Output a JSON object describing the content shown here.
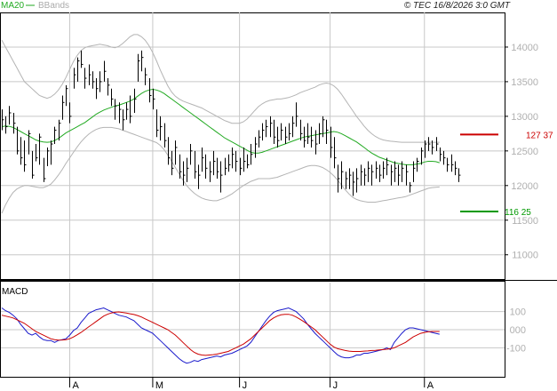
{
  "header": {
    "legend": [
      {
        "label": "MA20",
        "color": "#22aa22"
      },
      {
        "label": "BBands",
        "color": "#aaaaaa"
      }
    ],
    "copyright": "© TEC 16/8/2026 3:0 GMT"
  },
  "colors": {
    "price_bar": "#000000",
    "ma20": "#22aa22",
    "bbands": "#b4b4b4",
    "grid": "#c8c8c8",
    "resistance": "#cc0000",
    "support": "#009900",
    "macd": "#1a1acc",
    "signal": "#cc0000"
  },
  "chart_data": [
    {
      "type": "line",
      "name": "price",
      "ylim": [
        10650,
        14500
      ],
      "yticks": [
        11000,
        11500,
        12000,
        12500,
        13000,
        13500,
        14000
      ],
      "x_month_labels": [
        {
          "label": "A",
          "index": 18
        },
        {
          "label": "M",
          "index": 40
        },
        {
          "label": "J",
          "index": 63
        },
        {
          "label": "J",
          "index": 87
        },
        {
          "label": "A",
          "index": 112
        }
      ],
      "levels": [
        {
          "name": "resistance",
          "value": 12737,
          "label": "127 37"
        },
        {
          "name": "support",
          "value": 11625,
          "label": "116 25"
        }
      ],
      "bars_hlc": [
        [
          13100,
          12800,
          12950
        ],
        [
          13000,
          12750,
          12850
        ],
        [
          13150,
          12880,
          13050
        ],
        [
          13050,
          12750,
          12900
        ],
        [
          12850,
          12450,
          12500
        ],
        [
          12700,
          12300,
          12400
        ],
        [
          12650,
          12200,
          12300
        ],
        [
          12800,
          12450,
          12750
        ],
        [
          12500,
          12100,
          12150
        ],
        [
          12600,
          12350,
          12400
        ],
        [
          12750,
          12300,
          12700
        ],
        [
          12400,
          12050,
          12100
        ],
        [
          12550,
          12280,
          12500
        ],
        [
          12650,
          12300,
          12600
        ],
        [
          12850,
          12600,
          12800
        ],
        [
          12950,
          12650,
          12900
        ],
        [
          13300,
          12950,
          13200
        ],
        [
          13450,
          13150,
          13400
        ],
        [
          13200,
          12900,
          13000
        ],
        [
          13700,
          13400,
          13600
        ],
        [
          13850,
          13500,
          13800
        ],
        [
          13950,
          13700,
          13750
        ],
        [
          13700,
          13400,
          13550
        ],
        [
          13750,
          13450,
          13600
        ],
        [
          13650,
          13400,
          13500
        ],
        [
          13550,
          13250,
          13400
        ],
        [
          13650,
          13350,
          13500
        ],
        [
          13800,
          13500,
          13650
        ],
        [
          13550,
          13300,
          13450
        ],
        [
          13400,
          13150,
          13250
        ],
        [
          13250,
          12950,
          13150
        ],
        [
          13200,
          12900,
          13100
        ],
        [
          13100,
          12800,
          12950
        ],
        [
          13200,
          12950,
          13100
        ],
        [
          13300,
          12900,
          13000
        ],
        [
          13400,
          13050,
          13250
        ],
        [
          13900,
          13500,
          13800
        ],
        [
          13950,
          13650,
          13850
        ],
        [
          13700,
          13450,
          13600
        ],
        [
          13550,
          13200,
          13300
        ],
        [
          13400,
          13100,
          13250
        ],
        [
          13100,
          12700,
          12800
        ],
        [
          13000,
          12650,
          12850
        ],
        [
          12900,
          12550,
          12650
        ],
        [
          12700,
          12300,
          12400
        ],
        [
          12500,
          12150,
          12250
        ],
        [
          12650,
          12300,
          12550
        ],
        [
          12450,
          12100,
          12200
        ],
        [
          12350,
          12000,
          12150
        ],
        [
          12400,
          12050,
          12250
        ],
        [
          12600,
          12300,
          12500
        ],
        [
          12500,
          12100,
          12200
        ],
        [
          12300,
          11950,
          12150
        ],
        [
          12550,
          12200,
          12400
        ],
        [
          12450,
          12100,
          12250
        ],
        [
          12350,
          12050,
          12200
        ],
        [
          12500,
          12150,
          12350
        ],
        [
          12400,
          12100,
          12200
        ],
        [
          12350,
          11900,
          12150
        ],
        [
          12400,
          12150,
          12250
        ],
        [
          12450,
          12200,
          12300
        ],
        [
          12550,
          12250,
          12450
        ],
        [
          12500,
          12200,
          12350
        ],
        [
          12400,
          12150,
          12250
        ],
        [
          12550,
          12200,
          12350
        ],
        [
          12450,
          12250,
          12300
        ],
        [
          12600,
          12300,
          12450
        ],
        [
          12700,
          12400,
          12600
        ],
        [
          12800,
          12550,
          12700
        ],
        [
          12900,
          12650,
          12800
        ],
        [
          12950,
          12700,
          12850
        ],
        [
          13000,
          12700,
          12900
        ],
        [
          12950,
          12600,
          12700
        ],
        [
          12850,
          12550,
          12650
        ],
        [
          12900,
          12650,
          12800
        ],
        [
          12850,
          12600,
          12700
        ],
        [
          12900,
          12650,
          12750
        ],
        [
          13000,
          12700,
          12900
        ],
        [
          13200,
          12850,
          13000
        ],
        [
          12950,
          12650,
          12750
        ],
        [
          12850,
          12550,
          12650
        ],
        [
          12900,
          12600,
          12700
        ],
        [
          12850,
          12550,
          12650
        ],
        [
          12800,
          12450,
          12600
        ],
        [
          12900,
          12600,
          12750
        ],
        [
          13000,
          12700,
          12950
        ],
        [
          12950,
          12600,
          12800
        ],
        [
          12850,
          12400,
          12550
        ],
        [
          12700,
          12250,
          12400
        ],
        [
          12300,
          11900,
          12100
        ],
        [
          12350,
          11950,
          12200
        ],
        [
          12200,
          11950,
          12100
        ],
        [
          12250,
          11950,
          12150
        ],
        [
          12200,
          11850,
          12050
        ],
        [
          12250,
          11900,
          12100
        ],
        [
          12300,
          12000,
          12200
        ],
        [
          12250,
          12000,
          12150
        ],
        [
          12350,
          12050,
          12250
        ],
        [
          12300,
          12000,
          12200
        ],
        [
          12350,
          12100,
          12250
        ],
        [
          12300,
          12050,
          12150
        ],
        [
          12350,
          12100,
          12250
        ],
        [
          12400,
          12150,
          12300
        ],
        [
          12300,
          12000,
          12200
        ],
        [
          12350,
          12050,
          12250
        ],
        [
          12300,
          12000,
          12150
        ],
        [
          12350,
          12050,
          12250
        ],
        [
          12300,
          12000,
          12200
        ],
        [
          12050,
          11900,
          12000
        ],
        [
          12350,
          12050,
          12250
        ],
        [
          12400,
          12200,
          12350
        ],
        [
          12550,
          12300,
          12500
        ],
        [
          12650,
          12400,
          12600
        ],
        [
          12700,
          12500,
          12600
        ],
        [
          12650,
          12450,
          12550
        ],
        [
          12700,
          12500,
          12600
        ],
        [
          12550,
          12350,
          12450
        ],
        [
          12500,
          12300,
          12400
        ],
        [
          12400,
          12200,
          12300
        ],
        [
          12450,
          12200,
          12300
        ],
        [
          12350,
          12150,
          12250
        ],
        [
          12250,
          12050,
          12150
        ]
      ],
      "ma20": [
        12850,
        12860,
        12855,
        12840,
        12810,
        12780,
        12750,
        12720,
        12690,
        12660,
        12640,
        12630,
        12625,
        12630,
        12650,
        12680,
        12720,
        12760,
        12790,
        12820,
        12850,
        12880,
        12910,
        12950,
        12990,
        13030,
        13060,
        13090,
        13110,
        13130,
        13150,
        13160,
        13180,
        13200,
        13220,
        13250,
        13290,
        13330,
        13360,
        13380,
        13390,
        13380,
        13360,
        13330,
        13290,
        13250,
        13210,
        13170,
        13130,
        13090,
        13050,
        13010,
        12970,
        12930,
        12890,
        12850,
        12810,
        12770,
        12730,
        12690,
        12660,
        12630,
        12600,
        12570,
        12540,
        12510,
        12480,
        12470,
        12470,
        12480,
        12500,
        12520,
        12540,
        12560,
        12580,
        12600,
        12620,
        12640,
        12660,
        12680,
        12700,
        12710,
        12720,
        12730,
        12740,
        12750,
        12760,
        12770,
        12780,
        12770,
        12750,
        12720,
        12690,
        12660,
        12630,
        12590,
        12550,
        12510,
        12470,
        12440,
        12410,
        12390,
        12370,
        12350,
        12330,
        12320,
        12310,
        12300,
        12300,
        12300,
        12310,
        12320,
        12340,
        12350,
        12350,
        12345,
        12330
      ],
      "bb_upper": [
        14100,
        14000,
        13900,
        13800,
        13700,
        13600,
        13500,
        13450,
        13400,
        13350,
        13300,
        13280,
        13260,
        13280,
        13320,
        13380,
        13460,
        13560,
        13680,
        13790,
        13880,
        13950,
        13990,
        14010,
        14020,
        14030,
        14040,
        14030,
        14020,
        14000,
        13990,
        14010,
        14050,
        14100,
        14150,
        14180,
        14180,
        14150,
        14100,
        14020,
        13920,
        13800,
        13670,
        13550,
        13440,
        13350,
        13290,
        13250,
        13220,
        13200,
        13180,
        13160,
        13140,
        13120,
        13090,
        13060,
        13030,
        13000,
        12970,
        12940,
        12920,
        12900,
        12900,
        12900,
        12920,
        12960,
        13020,
        13080,
        13140,
        13180,
        13210,
        13230,
        13240,
        13250,
        13250,
        13260,
        13270,
        13290,
        13310,
        13340,
        13360,
        13380,
        13400,
        13420,
        13450,
        13470,
        13480,
        13470,
        13440,
        13390,
        13320,
        13240,
        13160,
        13080,
        13000,
        12930,
        12860,
        12800,
        12750,
        12710,
        12680,
        12660,
        12650,
        12640,
        12635,
        12630,
        12625,
        12625,
        12625,
        12625,
        12625,
        12625,
        12625,
        12625,
        12625,
        12625,
        12625
      ],
      "bb_lower": [
        11600,
        11720,
        11820,
        11900,
        11950,
        11980,
        12000,
        12000,
        11990,
        11980,
        11970,
        11970,
        11990,
        12020,
        12080,
        12150,
        12230,
        12320,
        12400,
        12480,
        12560,
        12630,
        12690,
        12740,
        12780,
        12810,
        12830,
        12840,
        12840,
        12840,
        12830,
        12820,
        12800,
        12780,
        12760,
        12740,
        12720,
        12700,
        12680,
        12660,
        12640,
        12620,
        12580,
        12520,
        12440,
        12350,
        12260,
        12170,
        12080,
        12000,
        11940,
        11890,
        11850,
        11820,
        11800,
        11790,
        11780,
        11780,
        11800,
        11820,
        11850,
        11880,
        11920,
        11960,
        12000,
        12030,
        12060,
        12080,
        12100,
        12100,
        12100,
        12100,
        12110,
        12120,
        12140,
        12160,
        12180,
        12200,
        12220,
        12240,
        12260,
        12280,
        12290,
        12290,
        12280,
        12260,
        12230,
        12190,
        12140,
        12080,
        12010,
        11940,
        11880,
        11830,
        11800,
        11780,
        11770,
        11760,
        11760,
        11760,
        11770,
        11780,
        11790,
        11800,
        11810,
        11820,
        11830,
        11840,
        11860,
        11880,
        11900,
        11920,
        11940,
        11960,
        11970,
        11975,
        11980
      ]
    },
    {
      "type": "line",
      "name": "MACD",
      "ylim": [
        -260,
        260
      ],
      "yticks": [
        100,
        0,
        -100
      ],
      "ytick_labels": [
        "100",
        "000",
        "-100"
      ],
      "series": [
        {
          "name": "MACD",
          "values": [
            120,
            105,
            95,
            80,
            60,
            30,
            5,
            -20,
            -30,
            -20,
            -40,
            -55,
            -60,
            -60,
            -70,
            -60,
            -55,
            -50,
            -30,
            -5,
            10,
            40,
            65,
            90,
            100,
            110,
            115,
            120,
            110,
            100,
            90,
            80,
            75,
            70,
            60,
            50,
            30,
            10,
            0,
            -10,
            -20,
            -40,
            -60,
            -80,
            -100,
            -120,
            -140,
            -160,
            -175,
            -185,
            -180,
            -170,
            -175,
            -165,
            -160,
            -155,
            -150,
            -145,
            -150,
            -140,
            -135,
            -130,
            -120,
            -110,
            -100,
            -90,
            -70,
            -40,
            -10,
            20,
            50,
            75,
            95,
            105,
            110,
            115,
            120,
            110,
            100,
            80,
            60,
            30,
            5,
            -20,
            -40,
            -60,
            -80,
            -100,
            -120,
            -140,
            -150,
            -155,
            -155,
            -150,
            -140,
            -140,
            -130,
            -130,
            -125,
            -120,
            -115,
            -110,
            -100,
            -110,
            -70,
            -45,
            -20,
            0,
            10,
            10,
            5,
            0,
            -5,
            -10,
            -15,
            -20,
            -25
          ]
        },
        {
          "name": "Signal",
          "values": [
            80,
            75,
            70,
            65,
            55,
            45,
            35,
            20,
            5,
            -10,
            -20,
            -30,
            -40,
            -50,
            -55,
            -58,
            -57,
            -55,
            -50,
            -40,
            -28,
            -15,
            0,
            15,
            30,
            45,
            60,
            75,
            85,
            92,
            96,
            98,
            95,
            92,
            88,
            84,
            78,
            70,
            60,
            50,
            40,
            30,
            20,
            10,
            0,
            -15,
            -30,
            -50,
            -70,
            -90,
            -110,
            -125,
            -135,
            -140,
            -142,
            -140,
            -138,
            -135,
            -130,
            -125,
            -120,
            -110,
            -100,
            -90,
            -80,
            -65,
            -50,
            -30,
            -10,
            10,
            30,
            50,
            65,
            75,
            82,
            85,
            85,
            80,
            70,
            58,
            45,
            30,
            15,
            0,
            -20,
            -40,
            -60,
            -80,
            -95,
            -105,
            -110,
            -115,
            -118,
            -120,
            -120,
            -120,
            -118,
            -117,
            -115,
            -114,
            -112,
            -110,
            -108,
            -105,
            -100,
            -90,
            -80,
            -70,
            -55,
            -40,
            -30,
            -20,
            -15,
            -12,
            -10,
            -10,
            -10
          ]
        }
      ]
    }
  ]
}
